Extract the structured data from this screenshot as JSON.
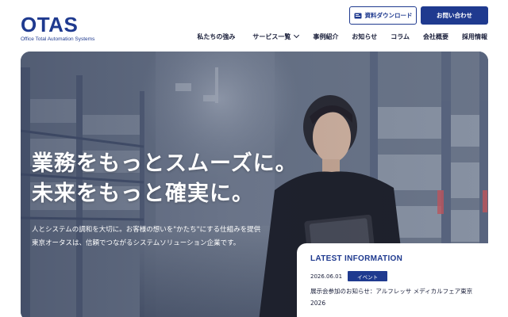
{
  "brand": {
    "logo_text": "OTAS",
    "logo_sub": "Office Total Automation Systems",
    "primary_color": "#1f3a8f"
  },
  "header": {
    "download_label": "資料ダウンロード",
    "download_icon": "document-icon",
    "contact_label": "お問い合わせ"
  },
  "nav": {
    "items": [
      {
        "label": "私たちの強み"
      },
      {
        "label": "サービス一覧",
        "has_dropdown": true
      },
      {
        "label": "事例紹介"
      },
      {
        "label": "お知らせ"
      },
      {
        "label": "コラム"
      },
      {
        "label": "会社概要"
      },
      {
        "label": "採用情報"
      }
    ]
  },
  "hero": {
    "headline_line1": "業務をもっとスムーズに。",
    "headline_line2": "未来をもっと確実に。",
    "lead_line1": "人とシステムの調和を大切に。お客様の想いを\"かたち\"にする仕組みを提供",
    "lead_line2": "東京オータスは、信頼でつながるシステムソリューション企業です。"
  },
  "latest": {
    "title": "LATEST INFORMATION",
    "date": "2026.06.01",
    "badge": "イベント",
    "text": "展示会参加のお知らせ：アルフレッサ メディカルフェア東京 2026"
  }
}
